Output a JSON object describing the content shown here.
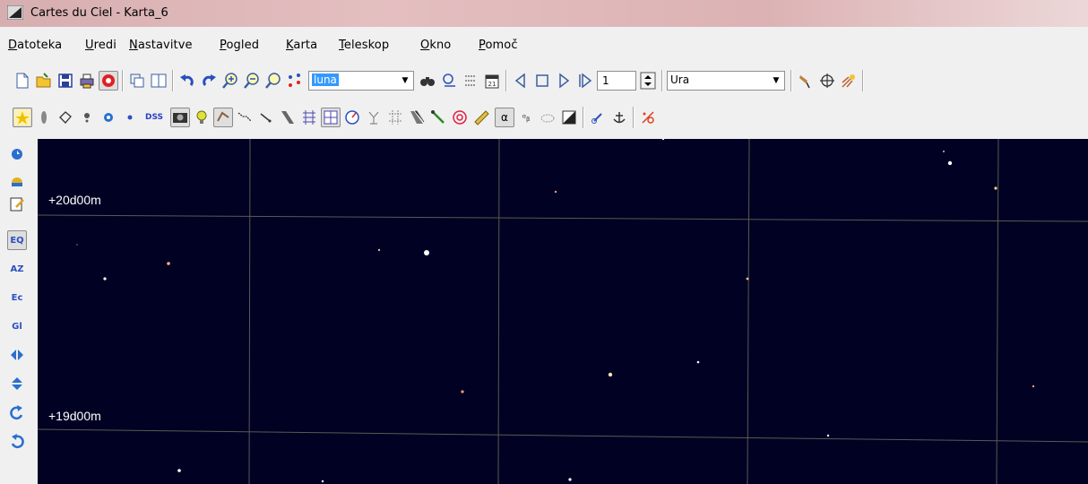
{
  "window": {
    "title": "Cartes du Ciel - Karta_6"
  },
  "menu": [
    "Datoteka",
    "Uredi",
    "Nastavitve",
    "Pogled",
    "Karta",
    "Teleskop",
    "Okno",
    "Pomoč"
  ],
  "toolbar": {
    "search_value": "luna",
    "time_step_value": "1",
    "time_unit_value": "Ura",
    "dss_label": "DSS"
  },
  "chart": {
    "background": "#010124",
    "grid_color": "#5a5a50",
    "dec_labels": [
      "+20d00m",
      "+19d00m"
    ],
    "stars": [
      {
        "color": "#ffffff"
      },
      {
        "color": "#ffffff"
      },
      {
        "color": "#ffffff"
      },
      {
        "color": "#ffd27a"
      },
      {
        "color": "#ff9a7a"
      },
      {
        "color": "#ffb080"
      },
      {
        "color": "#ffffff"
      },
      {
        "color": "#e8b080"
      },
      {
        "color": "#ffffff"
      },
      {
        "color": "#ffc080"
      },
      {
        "color": "#ffe0c0"
      },
      {
        "color": "#ffffff"
      },
      {
        "color": "#ff9a6a"
      },
      {
        "color": "#ff9a6a"
      },
      {
        "color": "#ffffff"
      },
      {
        "color": "#ffffff"
      },
      {
        "color": "#ffffff"
      },
      {
        "color": "#ffffff"
      },
      {
        "color": "#ffb080"
      }
    ]
  },
  "left_toolbar": {
    "eq_label": "EQ",
    "az_label": "AZ",
    "ec_label": "Ec",
    "gl_label": "Gl"
  }
}
